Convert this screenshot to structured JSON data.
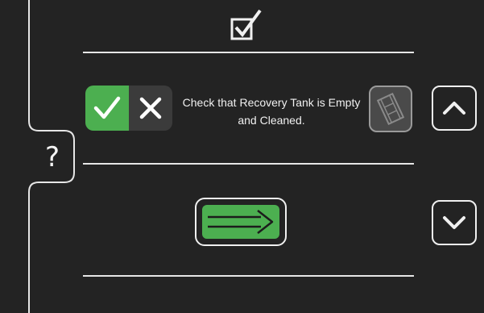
{
  "help": {
    "label": "?"
  },
  "step": {
    "instruction": "Check that Recovery Tank is Empty and Cleaned."
  },
  "colors": {
    "background": "#232323",
    "accent_green": "#4caf50",
    "line": "#e6e6e6"
  },
  "icons": {
    "header": "checkbox-check-icon",
    "confirm": "check-icon",
    "reject": "x-icon",
    "video": "film-icon",
    "up": "chevron-up-icon",
    "down": "chevron-down-icon",
    "next": "arrow-right-icon"
  }
}
